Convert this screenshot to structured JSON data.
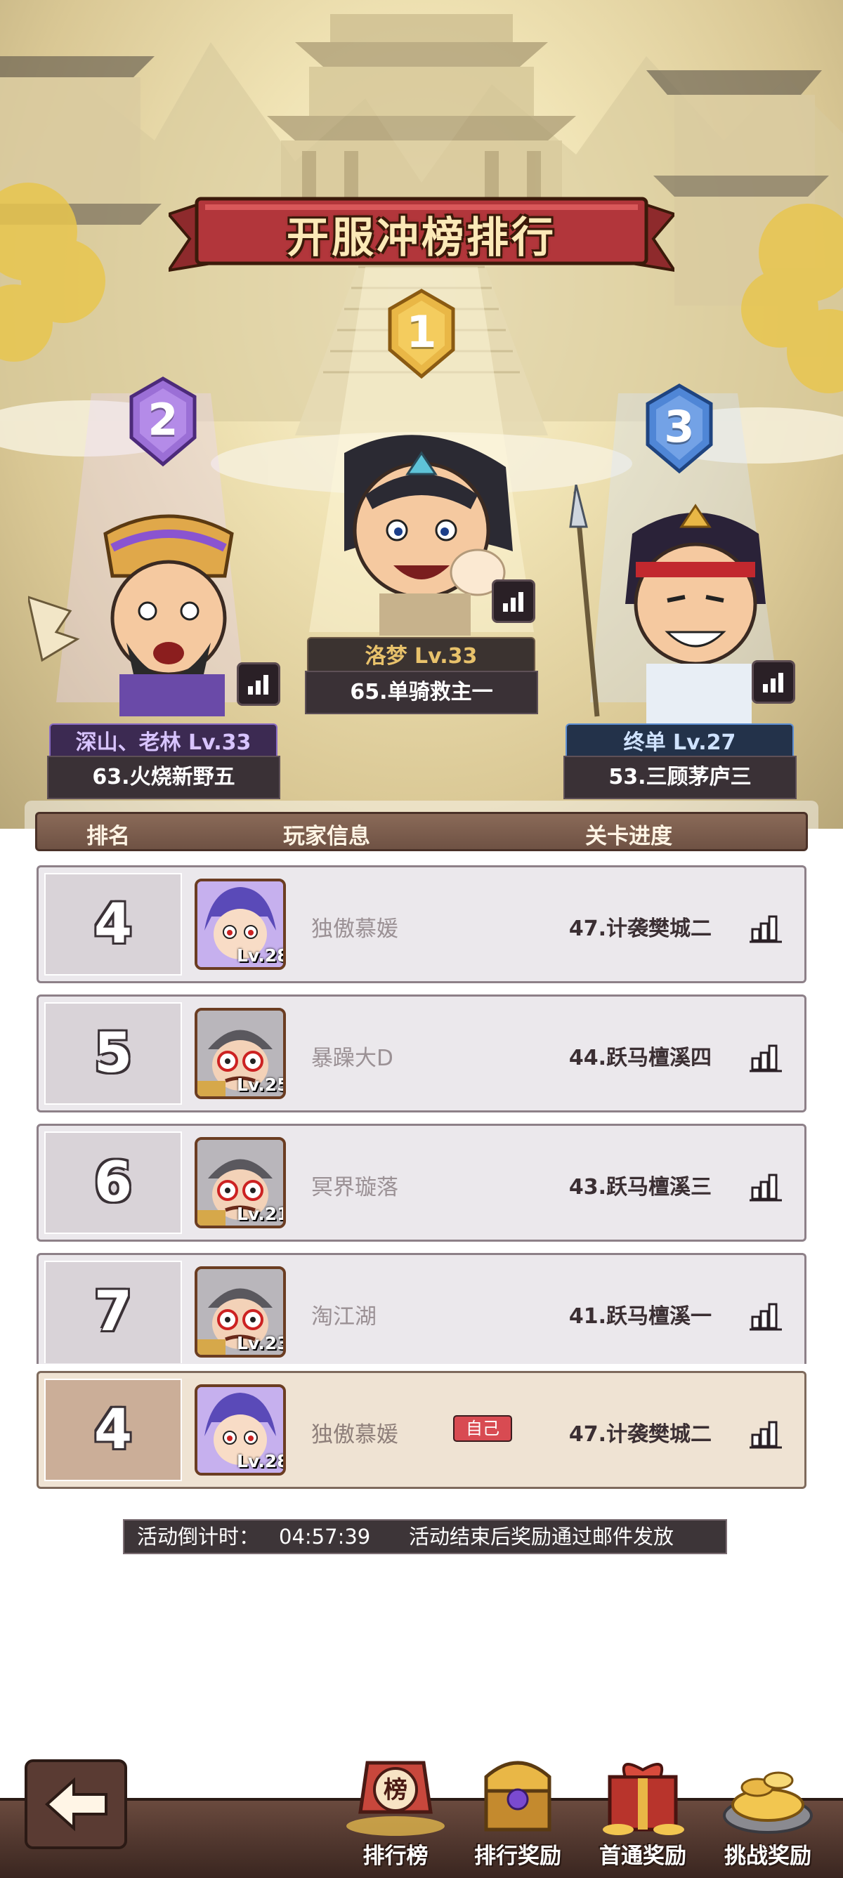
{
  "title": "开服冲榜排行",
  "podium": {
    "first": {
      "rank": "1",
      "name": "洛梦 Lv.33",
      "stage": "65.单骑救主一"
    },
    "second": {
      "rank": "2",
      "name": "深山、老林 Lv.33",
      "stage": "63.火烧新野五"
    },
    "third": {
      "rank": "3",
      "name": "终单 Lv.27",
      "stage": "53.三顾茅庐三"
    }
  },
  "table": {
    "header": {
      "rank": "排名",
      "player": "玩家信息",
      "progress": "关卡进度"
    },
    "rows": [
      {
        "rank": "4",
        "level": "Lv.28",
        "name": "独傲慕媛",
        "stage": "47.计袭樊城二",
        "avatar": "purple-hair-avatar"
      },
      {
        "rank": "5",
        "level": "Lv.25",
        "name": "暴躁大D",
        "stage": "44.跃马檀溪四",
        "avatar": "glasses-avatar"
      },
      {
        "rank": "6",
        "level": "Lv.21",
        "name": "冥界璇落",
        "stage": "43.跃马檀溪三",
        "avatar": "glasses-avatar"
      },
      {
        "rank": "7",
        "level": "Lv.23",
        "name": "淘江湖",
        "stage": "41.跃马檀溪一",
        "avatar": "glasses-avatar"
      }
    ],
    "self": {
      "rank": "4",
      "level": "Lv.28",
      "name": "独傲慕媛",
      "tag": "自己",
      "stage": "47.计袭樊城二",
      "avatar": "purple-hair-avatar"
    }
  },
  "countdown": {
    "label": "活动倒计时：",
    "time": "04:57:39",
    "note": "活动结束后奖励通过邮件发放"
  },
  "nav": [
    {
      "label": "排行榜",
      "icon": "ranking-scroll-icon"
    },
    {
      "label": "排行奖励",
      "icon": "treasure-chest-icon"
    },
    {
      "label": "首通奖励",
      "icon": "gift-box-icon"
    },
    {
      "label": "挑战奖励",
      "icon": "gold-pile-icon"
    }
  ],
  "nav_badge": "榜",
  "colors": {
    "gold": "#e9b746",
    "purple": "#9b6fd6",
    "blue": "#4f86d6",
    "banner_red": "#b2363b",
    "self_row": "#efe3d3"
  }
}
